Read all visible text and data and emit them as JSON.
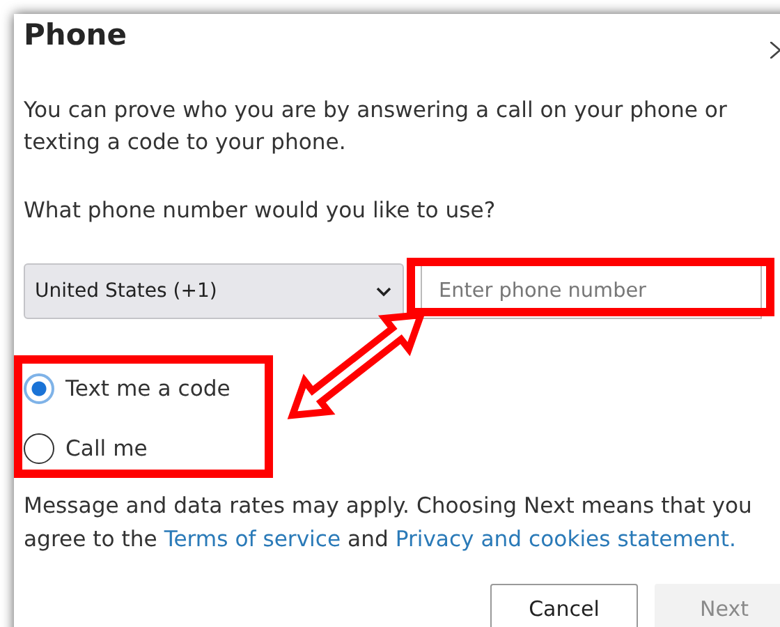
{
  "dialog": {
    "title": "Phone",
    "intro": "You can prove who you are by answering a call on your phone or texting a code to your phone.",
    "question": "What phone number would you like to use?",
    "country_select": {
      "value": "United States (+1)"
    },
    "phone_field": {
      "placeholder": "Enter phone number"
    },
    "methods": [
      {
        "label": "Text me a code",
        "selected": true
      },
      {
        "label": "Call me",
        "selected": false
      }
    ],
    "disclaimer": [
      {
        "kind": "text",
        "text": "Message and data rates may apply. Choosing Next means that you agree to the "
      },
      {
        "kind": "link",
        "text": "Terms of service"
      },
      {
        "kind": "text",
        "text": " and "
      },
      {
        "kind": "link",
        "text": "Privacy and cookies statement."
      }
    ],
    "buttons": [
      {
        "label": "Cancel",
        "kind": "secondary",
        "disabled": false
      },
      {
        "label": "Next",
        "kind": "primary",
        "disabled": true
      }
    ]
  }
}
